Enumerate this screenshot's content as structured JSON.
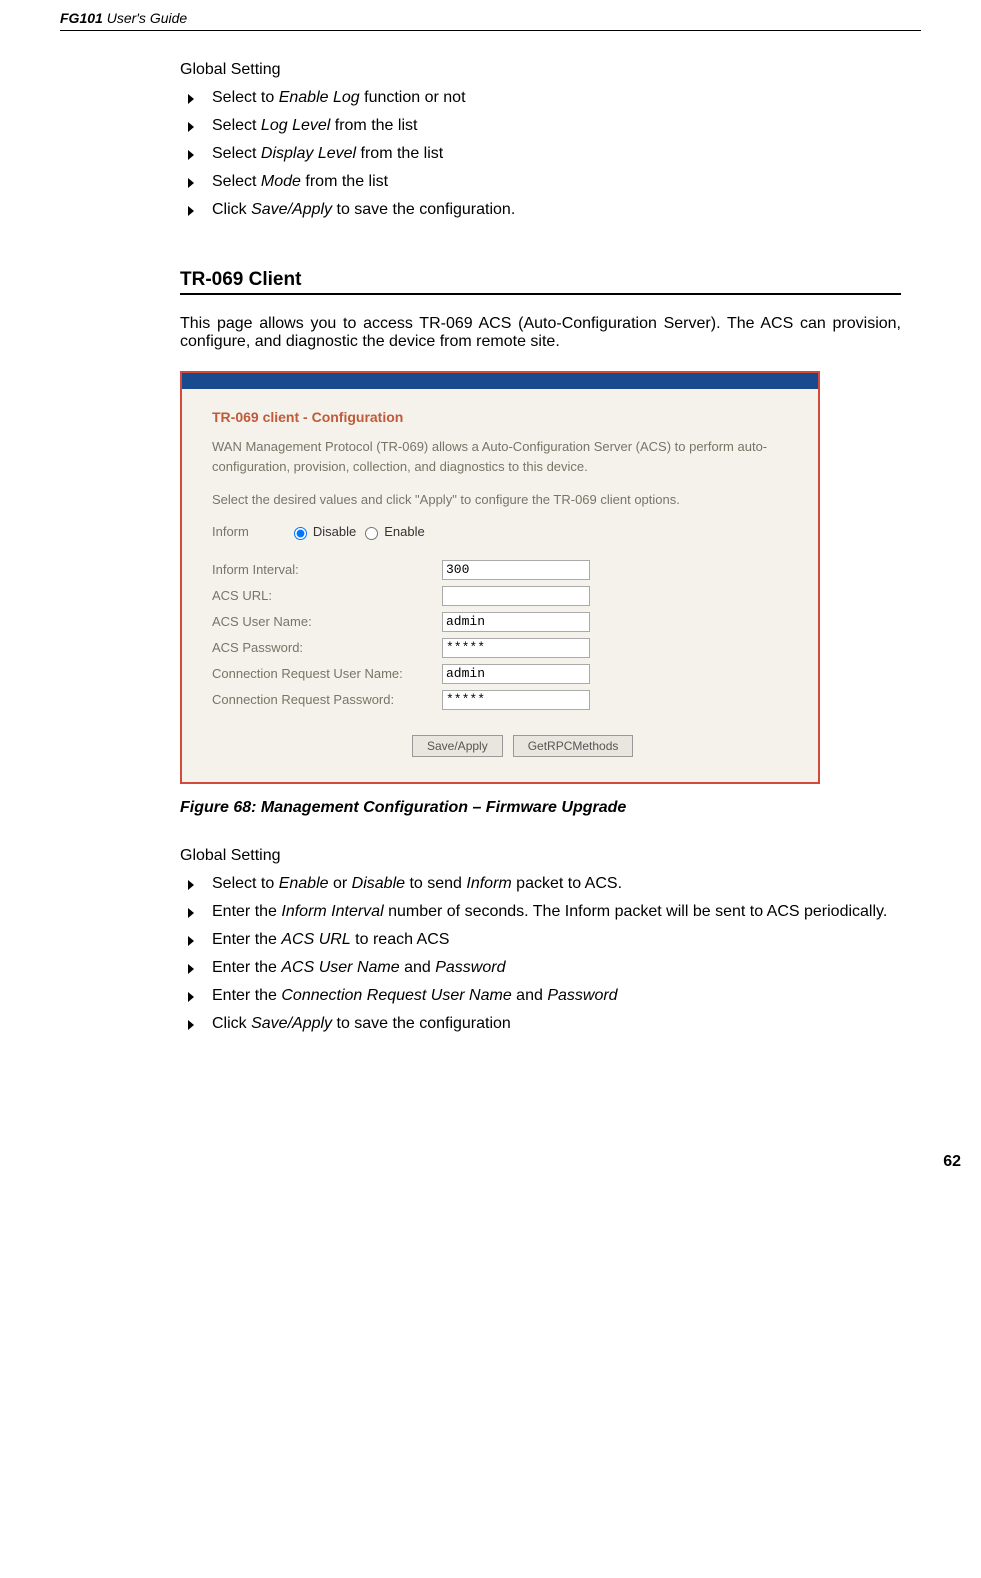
{
  "header": {
    "model": "FG101",
    "rest": " User's Guide"
  },
  "section1": {
    "title": "Global Setting",
    "items": [
      {
        "pre": "Select to ",
        "it": "Enable Log",
        "post": " function or not"
      },
      {
        "pre": "Select ",
        "it": "Log Level",
        "post": " from the list"
      },
      {
        "pre": "Select ",
        "it": "Display Level",
        "post": " from the list"
      },
      {
        "pre": "Select ",
        "it": "Mode",
        "post": " from the list"
      },
      {
        "pre": "Click ",
        "it": "Save/Apply",
        "post": " to save the configuration."
      }
    ]
  },
  "h2": "TR-069 Client",
  "intro": "This page allows you to access TR-069 ACS (Auto-Configuration Server). The ACS can provision, configure, and diagnostic the device from remote site.",
  "fig": {
    "title": "TR-069 client - Configuration",
    "desc1": "WAN Management Protocol (TR-069) allows a Auto-Configuration Server (ACS) to perform auto-configuration, provision, collection, and diagnostics to this device.",
    "desc2": "Select the desired values and click \"Apply\" to configure the TR-069 client options.",
    "informLabel": "Inform",
    "radios": {
      "disable": "Disable",
      "enable": "Enable",
      "selected": "disable"
    },
    "fields": {
      "interval": {
        "label": "Inform Interval:",
        "value": "300"
      },
      "acsurl": {
        "label": "ACS URL:",
        "value": ""
      },
      "acsuser": {
        "label": "ACS User Name:",
        "value": "admin"
      },
      "acspass": {
        "label": "ACS Password:",
        "value": "*****"
      },
      "cruser": {
        "label": "Connection Request User Name:",
        "value": "admin"
      },
      "crpass": {
        "label": "Connection Request Password:",
        "value": "*****"
      }
    },
    "buttons": {
      "save": "Save/Apply",
      "getrpc": "GetRPCMethods"
    }
  },
  "caption": "Figure 68: Management Configuration – Firmware Upgrade",
  "section2": {
    "title": "Global Setting",
    "items": [
      [
        {
          "t": "Select to "
        },
        {
          "t": "Enable",
          "i": true
        },
        {
          "t": " or "
        },
        {
          "t": "Disable",
          "i": true
        },
        {
          "t": " to send "
        },
        {
          "t": "Inform",
          "i": true
        },
        {
          "t": " packet to ACS."
        }
      ],
      [
        {
          "t": "Enter the "
        },
        {
          "t": "Inform Interval",
          "i": true
        },
        {
          "t": " number of seconds. The Inform packet will be sent to ACS periodically."
        }
      ],
      [
        {
          "t": "Enter the "
        },
        {
          "t": "ACS URL",
          "i": true
        },
        {
          "t": " to reach ACS"
        }
      ],
      [
        {
          "t": "Enter the "
        },
        {
          "t": "ACS User Name",
          "i": true
        },
        {
          "t": " and "
        },
        {
          "t": "Password",
          "i": true
        }
      ],
      [
        {
          "t": "Enter the "
        },
        {
          "t": "Connection Request User Name",
          "i": true
        },
        {
          "t": " and "
        },
        {
          "t": "Password",
          "i": true
        }
      ],
      [
        {
          "t": "Click "
        },
        {
          "t": "Save/Apply",
          "i": true
        },
        {
          "t": " to save the configuration"
        }
      ]
    ]
  },
  "pageNumber": "62"
}
